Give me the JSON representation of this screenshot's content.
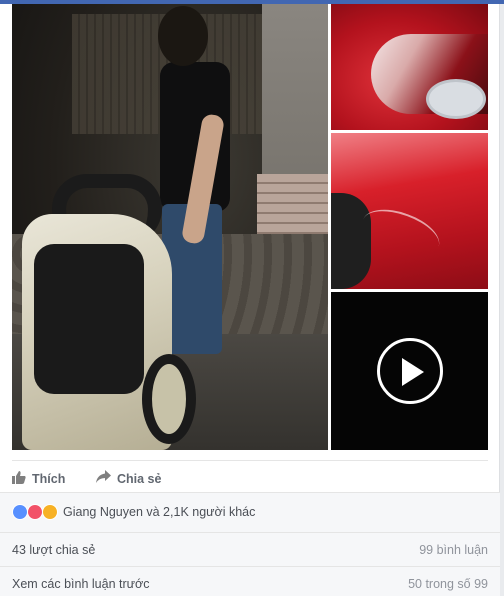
{
  "post": {
    "media": {
      "main_photo": {
        "icon": "street-scene-photo"
      },
      "side_photos": [
        {
          "icon": "car-taillight-photo"
        },
        {
          "icon": "scratched-car-door-photo"
        },
        {
          "icon": "video-thumbnail",
          "play_icon": "play-icon"
        }
      ]
    },
    "actions": {
      "like_label": "Thích",
      "like_icon": "thumbs-up-icon",
      "share_label": "Chia sẻ",
      "share_icon": "share-arrow-icon"
    },
    "reactions": {
      "icons": [
        "like-reaction-icon",
        "love-reaction-icon",
        "wow-reaction-icon"
      ],
      "summary": "Giang Nguyen và 2,1K người khác"
    },
    "stats": {
      "shares": "43 lượt chia sẻ",
      "comments": "99 bình luận"
    },
    "comments": {
      "view_previous": "Xem các bình luận trước",
      "count": "50 trong số 99"
    }
  },
  "colors": {
    "brand": "#4267b2",
    "like": "#5890ff",
    "love": "#f25268",
    "wow": "#f7b125",
    "action_text": "#616770"
  }
}
